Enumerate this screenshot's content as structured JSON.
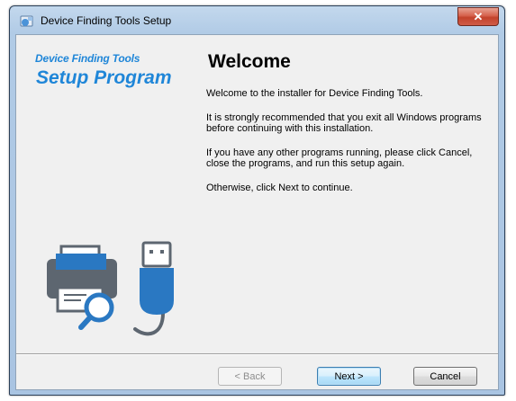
{
  "window": {
    "title": "Device Finding Tools Setup",
    "close_symbol": "✕"
  },
  "sidebar": {
    "brand_line1": "Device Finding Tools",
    "brand_line2": "Setup Program"
  },
  "content": {
    "heading": "Welcome",
    "p1": "Welcome to the installer for Device Finding Tools.",
    "p2": "It is strongly recommended that you exit all Windows programs before continuing with this installation.",
    "p3": "If you have any other programs running, please click Cancel, close the programs, and run this setup again.",
    "p4": "Otherwise, click Next to continue."
  },
  "buttons": {
    "back": "< Back",
    "next": "Next >",
    "cancel": "Cancel"
  },
  "colors": {
    "brand": "#1f86d8",
    "illustration_blue": "#2a78c2",
    "illustration_gray": "#5d6670"
  },
  "icons": {
    "app": "setup-icon",
    "illustration": "printer-usb-search-illustration"
  }
}
